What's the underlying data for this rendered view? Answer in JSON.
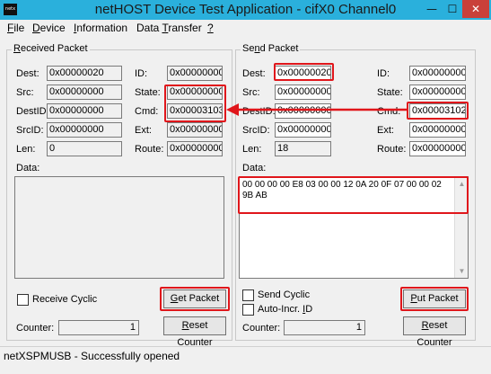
{
  "window": {
    "title": "netHOST Device Test Application - cifX0 Channel0",
    "icon_text": "netx"
  },
  "title_buttons": {
    "minimize": "—",
    "maximize": "☐",
    "close": "✕"
  },
  "menu": [
    {
      "label": "File",
      "accel": "F",
      "rest": "ile"
    },
    {
      "label": "Device",
      "accel": "D",
      "rest": "evice"
    },
    {
      "label": "Information",
      "accel": "I",
      "rest": "nformation"
    },
    {
      "label": "Data Transfer",
      "pre": "Data ",
      "accel": "T",
      "rest": "ransfer"
    },
    {
      "label": "?",
      "accel": "?",
      "rest": ""
    }
  ],
  "received": {
    "title_pre": "",
    "title_accel": "R",
    "title_rest": "eceived Packet",
    "labels": {
      "dest": "Dest:",
      "src": "Src:",
      "destid": "DestID:",
      "srcid": "SrcID:",
      "len": "Len:",
      "id": "ID:",
      "state": "State:",
      "cmd": "Cmd:",
      "ext": "Ext:",
      "route": "Route:",
      "data": "Data:"
    },
    "values": {
      "dest": "0x00000020",
      "src": "0x00000000",
      "destid": "0x00000000",
      "srcid": "0x00000000",
      "len": "0",
      "id": "0x00000000",
      "state": "0x00000000",
      "cmd": "0x00003103",
      "ext": "0x00000000",
      "route": "0x00000000"
    },
    "data": "",
    "receive_cyclic": "Receive Cyclic",
    "get_packet_accel": "G",
    "get_packet_rest": "et Packet",
    "counter_label": "Counter:",
    "counter_value": "1",
    "reset_counter_accel": "R",
    "reset_counter_rest": "eset Counter"
  },
  "send": {
    "title_pre": "Se",
    "title_accel": "n",
    "title_rest": "d Packet",
    "labels": {
      "dest": "Dest:",
      "src": "Src:",
      "destid": "DestID:",
      "srcid": "SrcID:",
      "len": "Len:",
      "id": "ID:",
      "state": "State:",
      "cmd": "Cmd:",
      "ext": "Ext:",
      "route": "Route:",
      "data": "Data:"
    },
    "values": {
      "dest": "0x00000020",
      "src": "0x00000000",
      "destid": "0x00000000",
      "srcid": "0x00000000",
      "len": "18",
      "id": "0x00000000",
      "state": "0x00000000",
      "cmd": "0x00003102",
      "ext": "0x00000000",
      "route": "0x00000000"
    },
    "data_line1": "00 00 00 00 E8 03 00 00 12 0A 20 0F 07 00 00 02",
    "data_line2": "9B AB",
    "send_cyclic": "Send Cyclic",
    "auto_incr_pre": "Auto-Incr. ",
    "auto_incr_accel": "I",
    "auto_incr_rest": "D",
    "put_packet_accel": "P",
    "put_packet_rest": "ut Packet",
    "counter_label": "Counter:",
    "counter_value": "1",
    "reset_counter_accel": "R",
    "reset_counter_rest": "eset Counter"
  },
  "status": "netXSPMUSB - Successfully opened",
  "highlight_color": "#e0161b"
}
